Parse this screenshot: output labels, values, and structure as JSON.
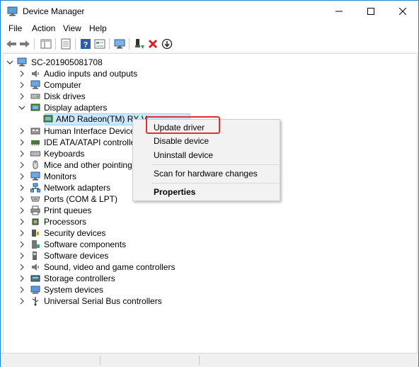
{
  "window": {
    "title": "Device Manager"
  },
  "menu": {
    "file": "File",
    "action": "Action",
    "view": "View",
    "help": "Help"
  },
  "toolbar": {
    "buttons": [
      "back-arrow-icon",
      "forward-arrow-icon",
      "show-hide-tree-icon",
      "properties-icon",
      "help-icon",
      "view-icon",
      "scan-hardware-icon",
      "update-driver-icon",
      "uninstall-icon",
      "disable-icon"
    ]
  },
  "tree": {
    "root": "SC-201905081708",
    "categories": [
      "Audio inputs and outputs",
      "Computer",
      "Disk drives",
      "Display adapters",
      "AMD Radeon(TM) RX V",
      "Human Interface Devices",
      "IDE ATA/ATAPI controllers",
      "Keyboards",
      "Mice and other pointing d",
      "Monitors",
      "Network adapters",
      "Ports (COM & LPT)",
      "Print queues",
      "Processors",
      "Security devices",
      "Software components",
      "Software devices",
      "Sound, video and game controllers",
      "Storage controllers",
      "System devices",
      "Universal Serial Bus controllers"
    ]
  },
  "context_menu": {
    "update_driver": "Update driver",
    "disable_device": "Disable device",
    "uninstall_device": "Uninstall device",
    "scan_changes": "Scan for hardware changes",
    "properties": "Properties"
  },
  "colors": {
    "accent": "#1883d7",
    "highlight": "#e03030",
    "selection": "#cce8ff"
  }
}
